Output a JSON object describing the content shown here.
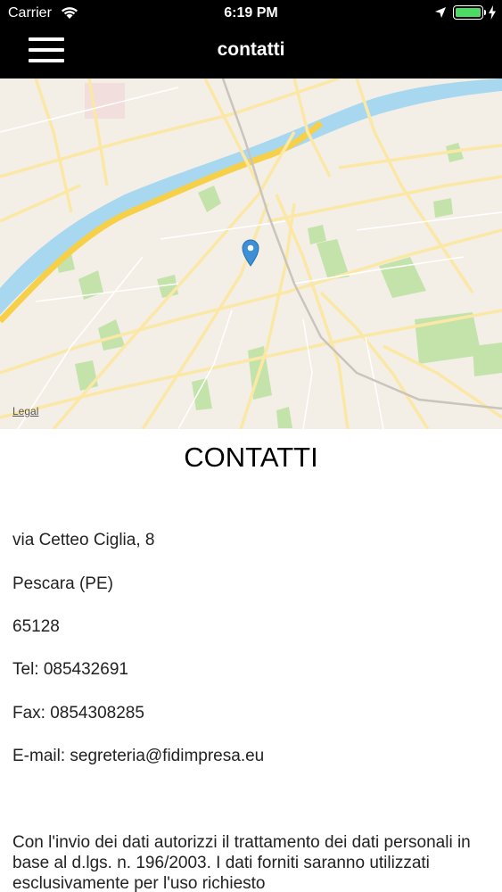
{
  "status_bar": {
    "carrier": "Carrier",
    "time": "6:19 PM",
    "wifi_icon": "wifi-icon",
    "location_icon": "location-arrow-icon",
    "battery_icon": "battery-icon",
    "battery_color": "#4cd964"
  },
  "nav": {
    "title": "contatti",
    "menu_icon": "hamburger-menu-icon"
  },
  "map": {
    "legal_label": "Legal",
    "pin_color": "#3d8fd6",
    "river_color": "#a7d8f0",
    "park_color": "#bfe3a8"
  },
  "contacts": {
    "heading": "CONTATTI",
    "address": "via Cetteo Ciglia, 8",
    "city": "Pescara (PE)",
    "zip": "65128",
    "tel": "Tel: 085432691",
    "fax": "Fax: 0854308285",
    "email": "E-mail:  segreteria@fidimpresa.eu",
    "privacy": "Con l'invio dei dati autorizzi il trattamento dei dati personali in base al d.lgs. n. 196/2003. I dati forniti saranno utilizzati esclusivamente per l'uso richiesto"
  }
}
